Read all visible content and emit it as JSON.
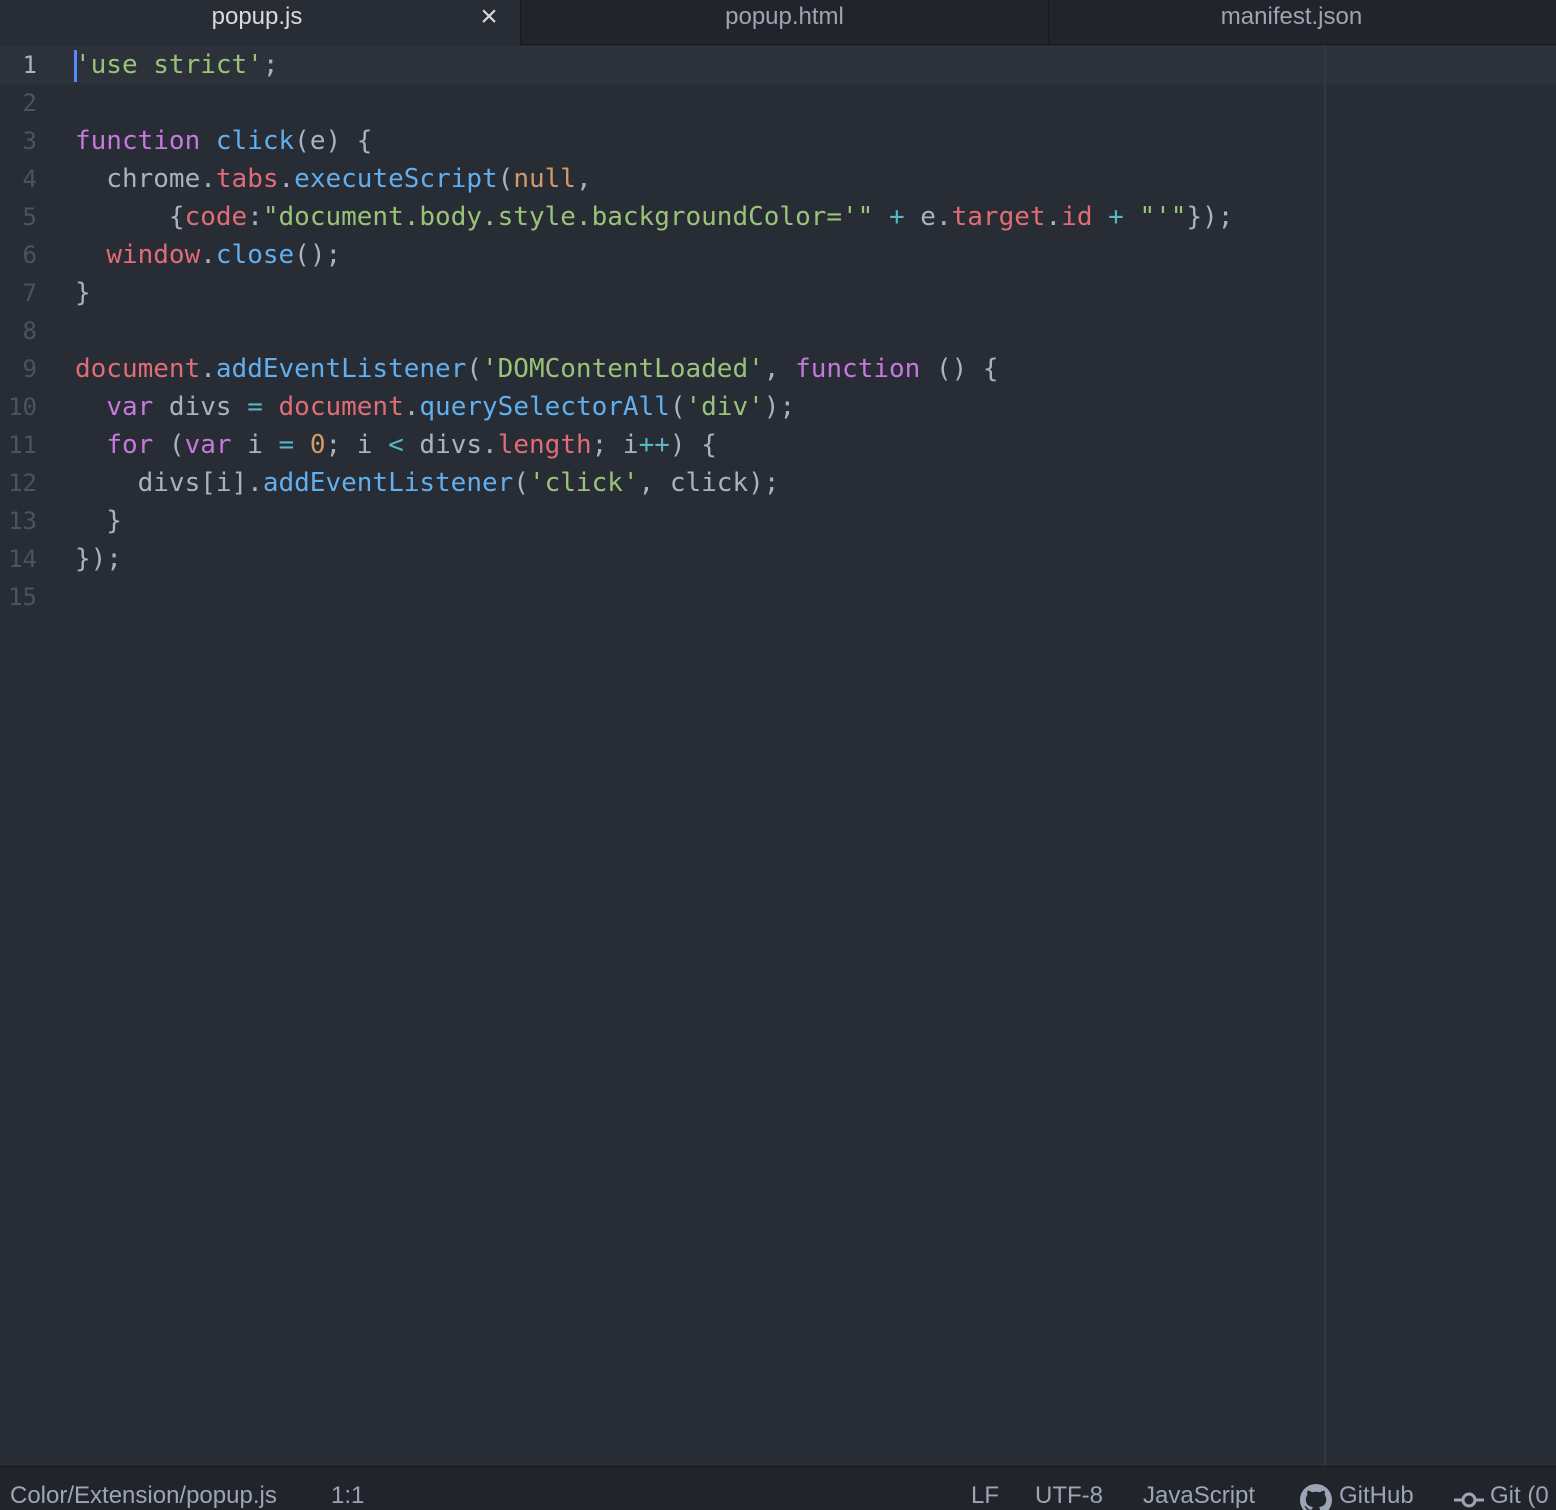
{
  "tabs": [
    {
      "title": "popup.js",
      "active": true,
      "close_glyph": "×"
    },
    {
      "title": "popup.html",
      "active": false
    },
    {
      "title": "manifest.json",
      "active": false
    }
  ],
  "editor": {
    "language": "JavaScript",
    "cursor_line": 1,
    "line_numbers": [
      "1",
      "2",
      "3",
      "4",
      "5",
      "6",
      "7",
      "8",
      "9",
      "10",
      "11",
      "12",
      "13",
      "14",
      "15"
    ],
    "lines": [
      "'use strict';",
      "",
      "function click(e) {",
      "  chrome.tabs.executeScript(null,",
      "      {code:\"document.body.style.backgroundColor='\" + e.target.id + \"'\"});",
      "  window.close();",
      "}",
      "",
      "document.addEventListener('DOMContentLoaded', function () {",
      "  var divs = document.querySelectorAll('div');",
      "  for (var i = 0; i < divs.length; i++) {",
      "    divs[i].addEventListener('click', click);",
      "  }",
      "});",
      ""
    ],
    "colors": {
      "background": "#282c34",
      "keyword": "#c678dd",
      "function": "#61afef",
      "string": "#98c379",
      "variable": "#e06c75",
      "number": "#d19a66",
      "operator": "#56b6c2",
      "plain": "#abb2bf",
      "cursor": "#528bff"
    }
  },
  "statusbar": {
    "file_path": "Color/Extension/popup.js",
    "cursor_position": "1:1",
    "line_ending": "LF",
    "encoding": "UTF-8",
    "grammar": "JavaScript",
    "github": "GitHub",
    "github_icon": "github-octocat-icon",
    "git": "Git (0",
    "git_icon": "git-commit-icon"
  }
}
